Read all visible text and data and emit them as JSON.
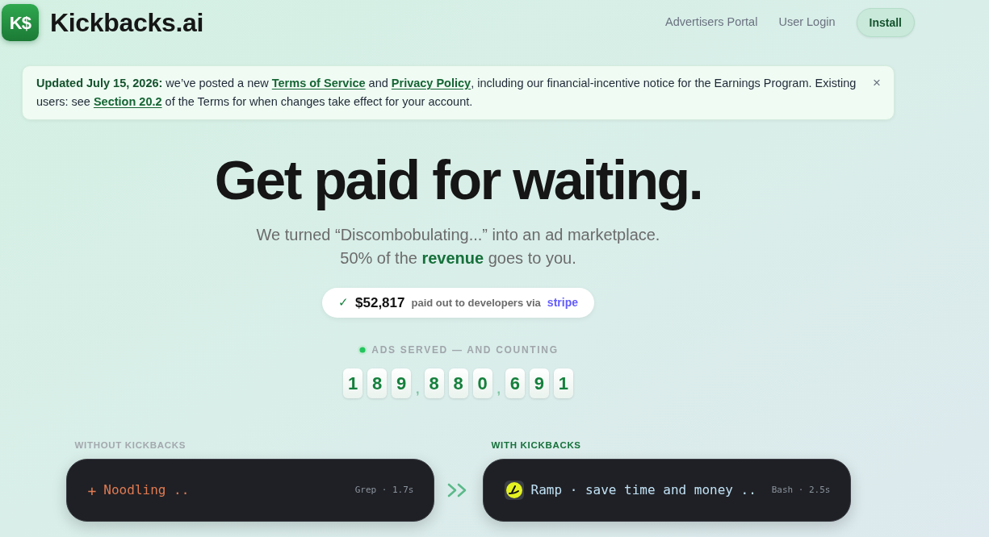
{
  "header": {
    "logo_text": "K$",
    "brand": "Kickbacks.ai",
    "nav_links": [
      "Advertisers Portal",
      "User Login"
    ],
    "install_button": "Install"
  },
  "notice": {
    "segments": [
      {
        "kind": "strong",
        "text": "Updated July 15, 2026:"
      },
      {
        "kind": "text",
        "text": " we’ve posted a new "
      },
      {
        "kind": "link",
        "text": "Terms of Service"
      },
      {
        "kind": "text",
        "text": " and "
      },
      {
        "kind": "link",
        "text": "Privacy Policy"
      },
      {
        "kind": "text",
        "text": ", including our financial-incentive notice for the Earnings Program. Existing users: see "
      },
      {
        "kind": "link",
        "text": "Section 20.2"
      },
      {
        "kind": "text",
        "text": " of the Terms for when changes take effect for your account."
      }
    ],
    "close": "×"
  },
  "hero": {
    "title": "Get paid for waiting.",
    "subtitle_lines": [
      "We turned “Discombobulating...” into an ad marketplace.",
      "50% of the **revenue** goes to you."
    ]
  },
  "payout": {
    "check": "✓",
    "amount": "$52,817",
    "label": "paid out to developers via",
    "provider": "stripe"
  },
  "counter": {
    "label": "ADS SERVED — AND COUNTING",
    "digits": [
      {
        "kind": "digit",
        "text": "1"
      },
      {
        "kind": "digit",
        "text": "8"
      },
      {
        "kind": "digit",
        "text": "9"
      },
      {
        "kind": "separator",
        "text": ","
      },
      {
        "kind": "digit",
        "text": "8"
      },
      {
        "kind": "digit",
        "text": "8"
      },
      {
        "kind": "digit",
        "text": "0"
      },
      {
        "kind": "separator",
        "text": ","
      },
      {
        "kind": "digit",
        "text": "6"
      },
      {
        "kind": "digit",
        "text": "9"
      },
      {
        "kind": "digit",
        "text": "1"
      }
    ]
  },
  "comparison": {
    "columns": [
      {
        "kind": "without",
        "label": "WITHOUT KICKBACKS",
        "spinner": "+",
        "status": "Noodling ..",
        "meta": "Grep · 1.7s"
      },
      {
        "kind": "with",
        "label": "WITH KICKBACKS",
        "status": "Ramp · save time and money ..",
        "meta": "Bash · 2.5s"
      }
    ]
  }
}
